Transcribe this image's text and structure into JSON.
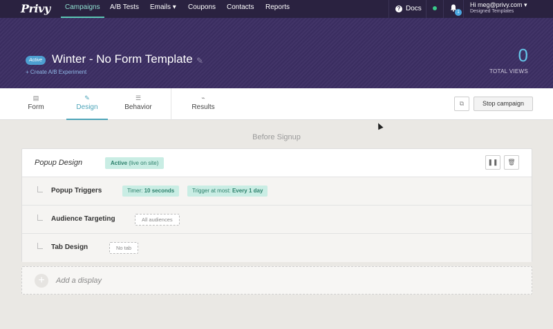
{
  "brand": {
    "logo_text": "Privy"
  },
  "nav": {
    "items": [
      {
        "label": "Campaigns",
        "active": true
      },
      {
        "label": "A/B Tests",
        "active": false
      },
      {
        "label": "Emails ▾",
        "active": false
      },
      {
        "label": "Coupons",
        "active": false
      },
      {
        "label": "Contacts",
        "active": false
      },
      {
        "label": "Reports",
        "active": false
      }
    ],
    "docs_label": "Docs",
    "notification_count": "1",
    "user_greeting": "Hi meg@privy.com ▾",
    "user_account": "Designed Templates"
  },
  "header": {
    "status": "Active",
    "title": "Winter - No Form Template",
    "create_ab_link": "+ Create A/B Experiment",
    "views_count": "0",
    "views_label": "TOTAL VIEWS"
  },
  "tabs": [
    {
      "label": "Form",
      "icon": "document-icon"
    },
    {
      "label": "Design",
      "icon": "brush-icon",
      "active": true
    },
    {
      "label": "Behavior",
      "icon": "sliders-icon"
    },
    {
      "label": "Results",
      "icon": "chart-icon"
    }
  ],
  "actions": {
    "stop_label": "Stop campaign"
  },
  "section": {
    "label": "Before Signup"
  },
  "display": {
    "title": "Popup Design",
    "status_bold": "Active",
    "status_rest": " (live on site)",
    "rows": [
      {
        "label": "Popup Triggers"
      },
      {
        "label": "Audience Targeting"
      },
      {
        "label": "Tab Design"
      }
    ],
    "trigger_timer_prefix": "Timer: ",
    "trigger_timer_value": "10 seconds",
    "trigger_freq_prefix": "Trigger at most: ",
    "trigger_freq_value": "Every 1 day",
    "audience_value": "All audiences",
    "tab_value": "No tab"
  },
  "add_display": {
    "label": "Add a display"
  },
  "colors": {
    "nav_bg": "#2a2240",
    "header_bg": "#3c2e63",
    "accent": "#4aa3b8",
    "chip_bg": "#c9ede4"
  }
}
